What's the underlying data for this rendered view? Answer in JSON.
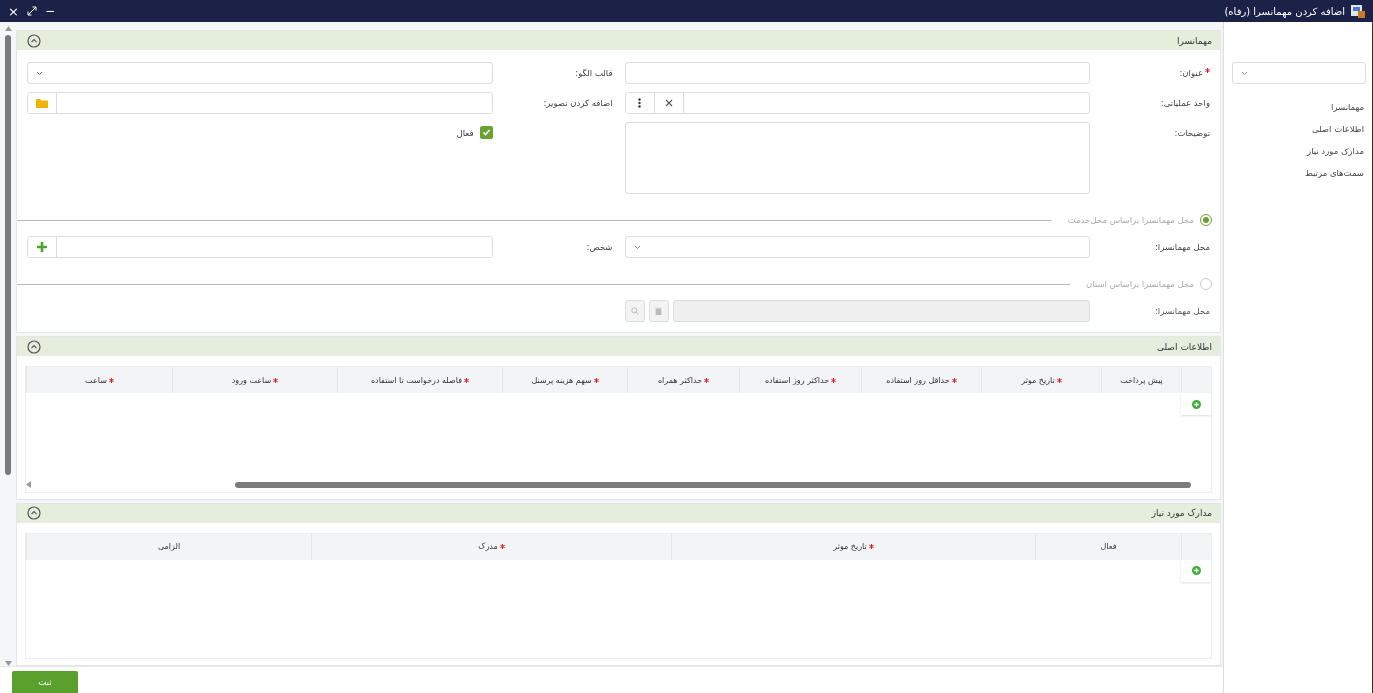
{
  "window": {
    "title": "اضافه کردن مهمانسرا (رفاه)",
    "close": "×",
    "minimize": "−"
  },
  "sidebar": {
    "items": [
      {
        "label": "مهمانسرا"
      },
      {
        "label": "اطلاعات اصلی"
      },
      {
        "label": "مدارک مورد نیاز"
      },
      {
        "label": "سمت‌های مرتبط"
      }
    ]
  },
  "guesthouse": {
    "title": "مهمانسرا",
    "columns": [
      [
        {
          "kind": "text",
          "label": "عنوان:",
          "required": true
        },
        {
          "kind": "lookup",
          "label": "واحد عملیاتی:",
          "required": false
        },
        {
          "kind": "textarea",
          "label": "توضیحات:",
          "required": false
        }
      ],
      [
        {
          "kind": "dropdown",
          "label": "قالب الگو:",
          "required": false
        },
        {
          "kind": "file",
          "label": "اضافه کردن تصویر:",
          "required": false
        },
        {
          "kind": "checkbox",
          "label": "فعال",
          "checked": true
        }
      ]
    ],
    "location_options": [
      {
        "label": "محل مهمانسرا براساس محل‌خدمت",
        "selected": true,
        "fields": [
          {
            "kind": "dropdown",
            "label": "محل مهمانسرا:"
          },
          {
            "kind": "person",
            "label": "شخص:"
          }
        ]
      },
      {
        "label": "محل مهمانسرا براساس استان",
        "selected": false,
        "fields": [
          {
            "kind": "search",
            "label": "محل مهمانسرا:"
          }
        ]
      }
    ]
  },
  "main_info": {
    "title": "اطلاعات اصلی",
    "columns": [
      {
        "label": "پیش پرداخت",
        "required": false
      },
      {
        "label": "تاریخ موثر",
        "required": true
      },
      {
        "label": "حداقل روز استفاده",
        "required": true
      },
      {
        "label": "حداکثر روز استفاده",
        "required": true
      },
      {
        "label": "حداکثر همراه",
        "required": true
      },
      {
        "label": "سهم هزینه پرسنل",
        "required": true
      },
      {
        "label": "فاصله درخواست تا استفاده",
        "required": true
      },
      {
        "label": "ساعت ورود",
        "required": true
      },
      {
        "label": "ساعت",
        "required": true
      }
    ]
  },
  "documents": {
    "title": "مدارک مورد نیاز",
    "columns": [
      {
        "label": "فعال",
        "required": false
      },
      {
        "label": "تاریخ موثر",
        "required": true
      },
      {
        "label": "مدرک",
        "required": true
      },
      {
        "label": "الزامی",
        "required": false
      }
    ]
  },
  "submit": "ثبت"
}
